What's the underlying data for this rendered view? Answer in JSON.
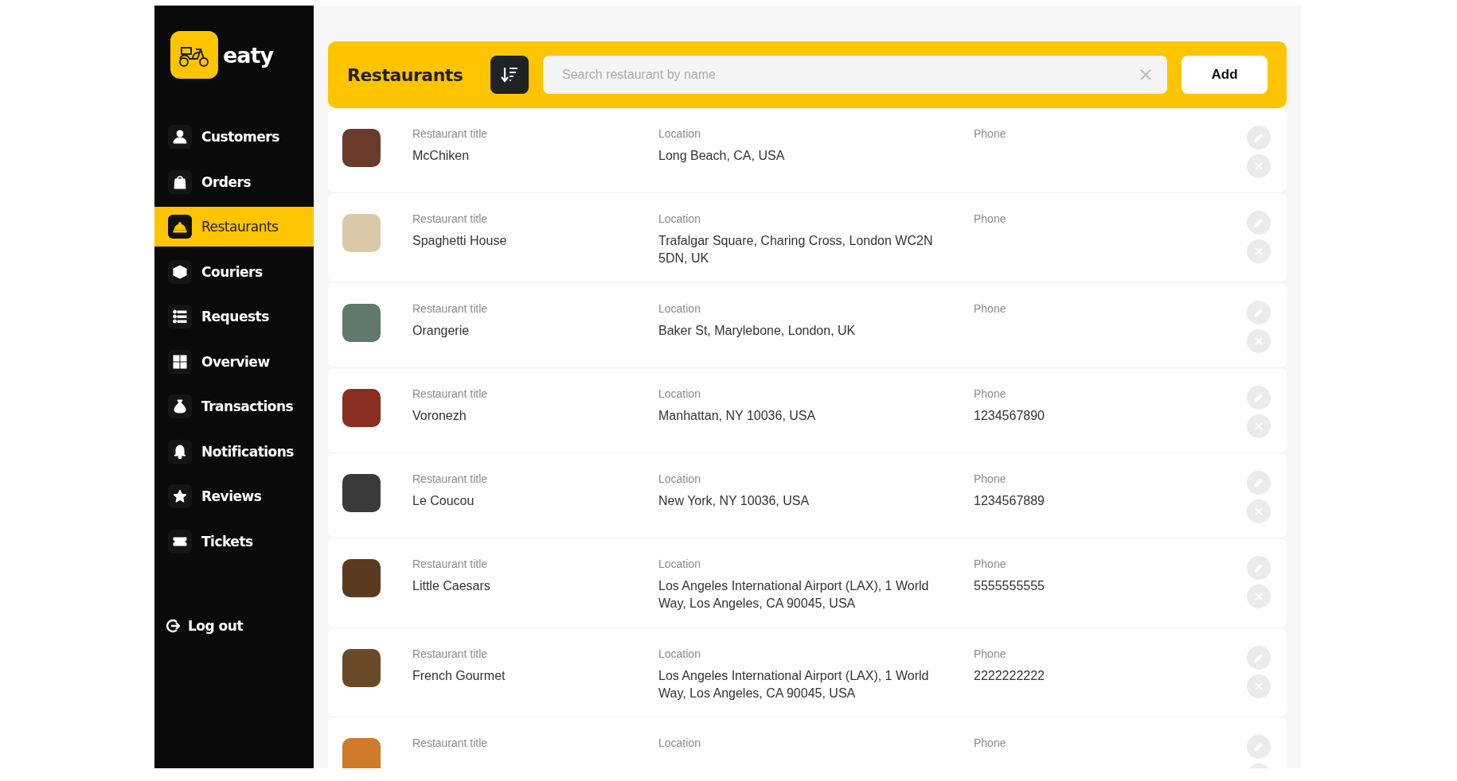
{
  "brand": {
    "name": "eaty"
  },
  "sidebar": {
    "items": [
      {
        "label": "Customers",
        "selected": false
      },
      {
        "label": "Orders",
        "selected": false
      },
      {
        "label": "Restaurants",
        "selected": true
      },
      {
        "label": "Couriers",
        "selected": false
      },
      {
        "label": "Requests",
        "selected": false
      },
      {
        "label": "Overview",
        "selected": false
      },
      {
        "label": "Transactions",
        "selected": false
      },
      {
        "label": "Notifications",
        "selected": false
      },
      {
        "label": "Reviews",
        "selected": false
      },
      {
        "label": "Tickets",
        "selected": false
      }
    ],
    "logout": "Log out"
  },
  "header": {
    "title": "Restaurants",
    "search": {
      "placeholder": "Search restaurant by name"
    },
    "add_button": "Add"
  },
  "restaurants": [
    {
      "fields": [
        {
          "label": "Restaurant title",
          "value": "McChiken"
        },
        {
          "label": "Location",
          "value": "Long Beach, CA, USA"
        },
        {
          "label": "Phone"
        }
      ]
    },
    {
      "fields": [
        {
          "label": "Restaurant title",
          "value": "Spaghetti House"
        },
        {
          "label": "Location",
          "value": "Trafalgar Square, Charing Cross, London WC2N 5DN, UK"
        },
        {
          "label": "Phone"
        }
      ]
    },
    {
      "fields": [
        {
          "label": "Restaurant title",
          "value": "Orangerie"
        },
        {
          "label": "Location",
          "value": "Baker St, Marylebone, London, UK"
        },
        {
          "label": "Phone"
        }
      ]
    },
    {
      "fields": [
        {
          "label": "Restaurant title",
          "value": "Voronezh"
        },
        {
          "label": "Location",
          "value": "Manhattan, NY 10036, USA"
        },
        {
          "label": "Phone",
          "value": "1234567890"
        }
      ]
    },
    {
      "fields": [
        {
          "label": "Restaurant title",
          "value": "Le Coucou"
        },
        {
          "label": "Location",
          "value": "New York, NY 10036, USA"
        },
        {
          "label": "Phone",
          "value": "1234567889"
        }
      ]
    },
    {
      "fields": [
        {
          "label": "Restaurant title",
          "value": "Little Caesars"
        },
        {
          "label": "Location",
          "value": "Los Angeles International Airport (LAX), 1 World Way, Los Angeles, CA 90045, USA"
        },
        {
          "label": "Phone",
          "value": "5555555555"
        }
      ]
    },
    {
      "fields": [
        {
          "label": "Restaurant title",
          "value": "French Gourmet"
        },
        {
          "label": "Location",
          "value": "Los Angeles International Airport (LAX), 1 World Way, Los Angeles, CA 90045, USA"
        },
        {
          "label": "Phone",
          "value": "2222222222"
        }
      ]
    },
    {
      "fields": [
        {
          "label": "Restaurant title"
        },
        {
          "label": "Location"
        },
        {
          "label": "Phone"
        }
      ]
    }
  ]
}
